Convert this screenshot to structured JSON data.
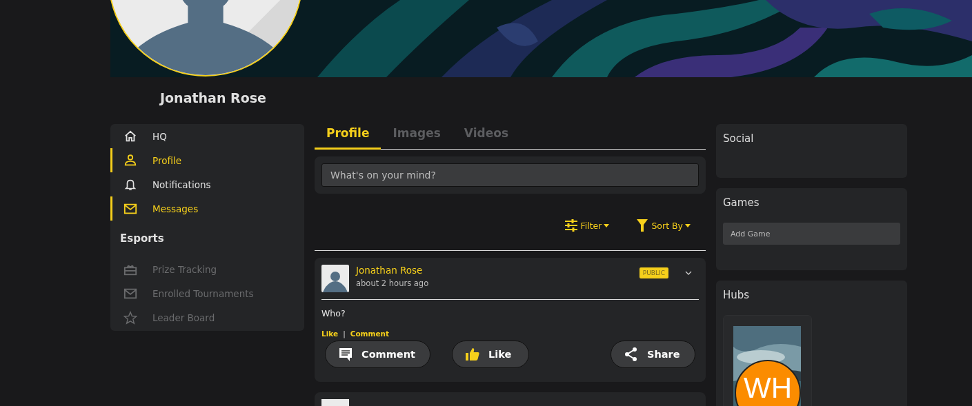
{
  "profile": {
    "name": "Jonathan Rose"
  },
  "nav": {
    "items": [
      {
        "label": "HQ",
        "selected": false
      },
      {
        "label": "Profile",
        "selected": true
      },
      {
        "label": "Notifications",
        "selected": false
      },
      {
        "label": "Messages",
        "selected": true
      }
    ],
    "section": {
      "title": "Esports",
      "items": [
        {
          "label": "Prize Tracking",
          "disabled": true
        },
        {
          "label": "Enrolled Tournaments",
          "disabled": true
        },
        {
          "label": "Leader Board",
          "disabled": true
        }
      ]
    }
  },
  "tabs": [
    {
      "label": "Profile",
      "selected": true
    },
    {
      "label": "Images",
      "selected": false
    },
    {
      "label": "Videos",
      "selected": false
    }
  ],
  "composer": {
    "placeholder": "What's on your mind?"
  },
  "toolbar": [
    "Filter",
    "Sort By"
  ],
  "posts": [
    {
      "author": "Jonathan Rose",
      "time": "about 2 hours ago",
      "visibility": "PUBLIC",
      "body": "Who?",
      "links": [
        "Like",
        "Comment"
      ],
      "link_separator": "|",
      "actions": [
        "Comment",
        "Like",
        "Share"
      ]
    }
  ],
  "widgets": {
    "social": {
      "title": "Social"
    },
    "games": {
      "title": "Games",
      "placeholder": "Add Game"
    },
    "hubs": {
      "title": "Hubs",
      "items": [
        {
          "initials": "WH"
        }
      ]
    }
  }
}
